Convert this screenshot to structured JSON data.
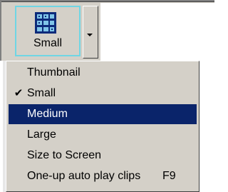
{
  "toolbar": {
    "size_button_label": "Small",
    "size_button_icon": "thumbnail-grid-icon",
    "dropdown_icon": "chevron-down-icon"
  },
  "menu": {
    "items": [
      {
        "label": "Thumbnail",
        "checked": false,
        "shortcut": ""
      },
      {
        "label": "Small",
        "checked": true,
        "shortcut": ""
      },
      {
        "label": "Medium",
        "checked": false,
        "shortcut": "",
        "highlighted": true
      },
      {
        "label": "Large",
        "checked": false,
        "shortcut": ""
      },
      {
        "label": "Size to Screen",
        "checked": false,
        "shortcut": ""
      },
      {
        "label": "One-up auto play clips",
        "checked": false,
        "shortcut": "F9"
      }
    ],
    "check_glyph": "✔"
  },
  "colors": {
    "highlight": "#0a246a",
    "button_border": "#6fd6e4"
  }
}
